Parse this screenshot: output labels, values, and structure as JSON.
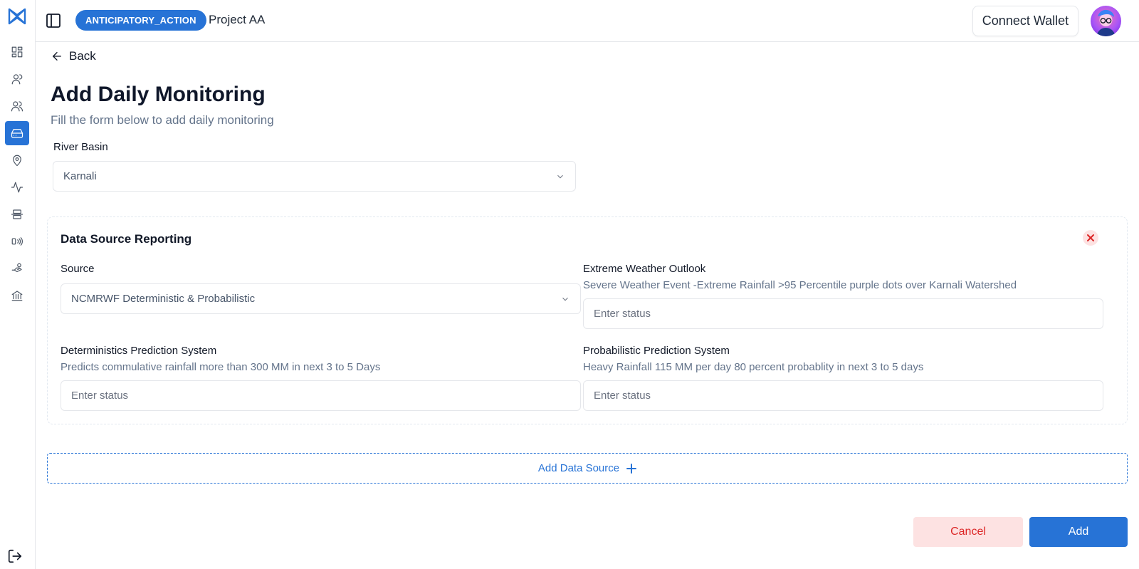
{
  "header": {
    "badge": "ANTICIPATORY_ACTION",
    "project_name": "Project AA",
    "connect_wallet": "Connect Wallet"
  },
  "sidebar": {
    "items": [
      {
        "icon": "dashboard-icon",
        "active": false
      },
      {
        "icon": "user-icon",
        "active": false
      },
      {
        "icon": "users-icon",
        "active": false
      },
      {
        "icon": "hard-drive-icon",
        "active": true
      },
      {
        "icon": "map-pin-icon",
        "active": false
      },
      {
        "icon": "activity-icon",
        "active": false
      },
      {
        "icon": "align-center-icon",
        "active": false
      },
      {
        "icon": "broadcast-icon",
        "active": false
      },
      {
        "icon": "hand-coins-icon",
        "active": false
      },
      {
        "icon": "bank-icon",
        "active": false
      }
    ],
    "logout_icon": "logout-icon"
  },
  "page": {
    "back_label": "Back",
    "title": "Add Daily Monitoring",
    "subtitle": "Fill the form below to add daily monitoring"
  },
  "river_basin": {
    "label": "River Basin",
    "value": "Karnali"
  },
  "data_source": {
    "title": "Data Source Reporting",
    "source_label": "Source",
    "source_value": "NCMRWF Deterministic & Probabilistic",
    "extreme_label": "Extreme Weather Outlook",
    "extreme_hint": "Severe Weather Event -Extreme Rainfall >95 Percentile purple dots over Karnali Watershed",
    "extreme_placeholder": "Enter status",
    "det_label": "Deterministics Prediction System",
    "det_hint": "Predicts commulative rainfall more than 300 MM in next 3 to 5 Days",
    "det_placeholder": "Enter status",
    "prob_label": "Probabilistic Prediction System",
    "prob_hint": "Heavy Rainfall 115 MM per day 80 percent probablity in next 3 to 5 days",
    "prob_placeholder": "Enter status"
  },
  "actions": {
    "add_data_source": "Add Data Source",
    "cancel": "Cancel",
    "add": "Add"
  },
  "colors": {
    "accent": "#2773d6",
    "danger": "#dc2626",
    "danger_bg": "#fde2e2"
  }
}
